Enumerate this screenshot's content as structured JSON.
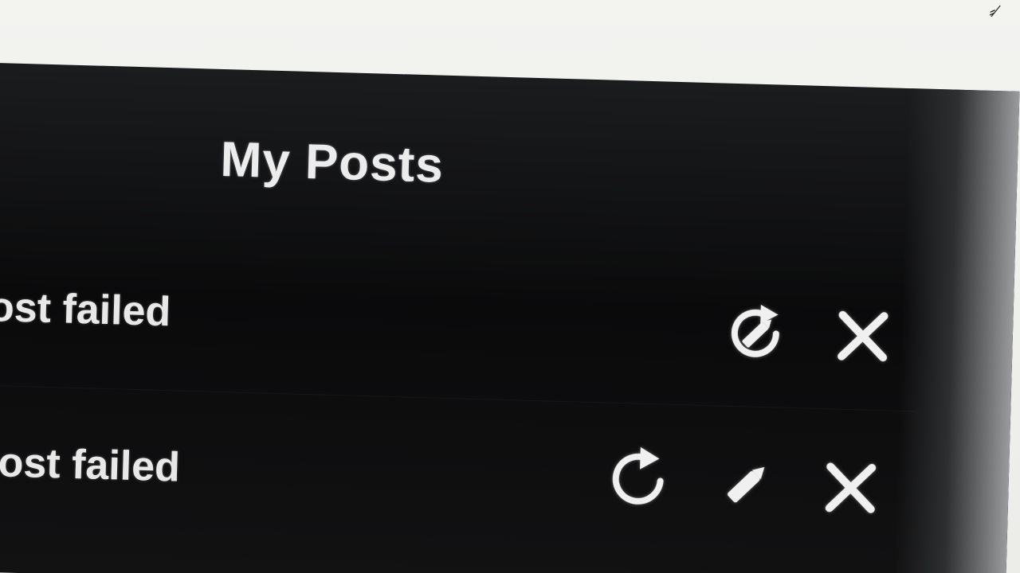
{
  "page": {
    "title": "My Posts"
  },
  "posts": [
    {
      "status": "Post failed"
    },
    {
      "status": "Post failed"
    }
  ],
  "icons": {
    "retry": "retry-icon",
    "edit": "pencil-icon",
    "delete": "close-icon",
    "retry_edit_overlap": "retry-edit-icon"
  },
  "colors": {
    "panel_background": "#0c0c0d",
    "text": "#ececec",
    "icon": "#f0f0f0"
  }
}
